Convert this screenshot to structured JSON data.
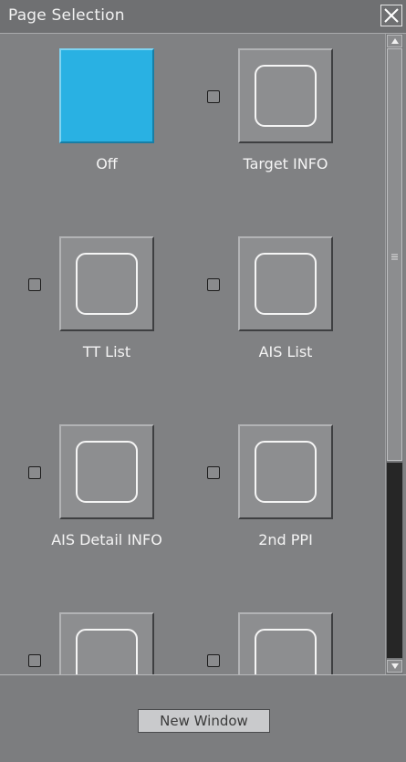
{
  "window": {
    "title": "Page Selection",
    "close_icon": "close-icon"
  },
  "pages": [
    {
      "label": "Off",
      "selected": true,
      "has_checkbox": false,
      "icon": "page-tile-icon"
    },
    {
      "label": "Target INFO",
      "selected": false,
      "has_checkbox": true,
      "checked": false,
      "icon": "page-tile-icon"
    },
    {
      "label": "TT List",
      "selected": false,
      "has_checkbox": true,
      "checked": false,
      "icon": "page-tile-icon"
    },
    {
      "label": "AIS List",
      "selected": false,
      "has_checkbox": true,
      "checked": false,
      "icon": "page-tile-icon"
    },
    {
      "label": "AIS Detail INFO",
      "selected": false,
      "has_checkbox": true,
      "checked": false,
      "icon": "page-tile-icon"
    },
    {
      "label": "2nd PPI",
      "selected": false,
      "has_checkbox": true,
      "checked": false,
      "icon": "page-tile-icon"
    },
    {
      "label": "",
      "selected": false,
      "has_checkbox": true,
      "checked": false,
      "icon": "page-tile-icon"
    },
    {
      "label": "",
      "selected": false,
      "has_checkbox": true,
      "checked": false,
      "icon": "page-tile-icon"
    }
  ],
  "scrollbar": {
    "up_icon": "scroll-up-icon",
    "down_icon": "scroll-down-icon",
    "grip_icon": "scroll-grip-icon"
  },
  "footer": {
    "new_window_label": "New Window"
  },
  "colors": {
    "selected_tile": "#29b1e3",
    "background": "#808183",
    "title_bar": "#6f7072"
  }
}
